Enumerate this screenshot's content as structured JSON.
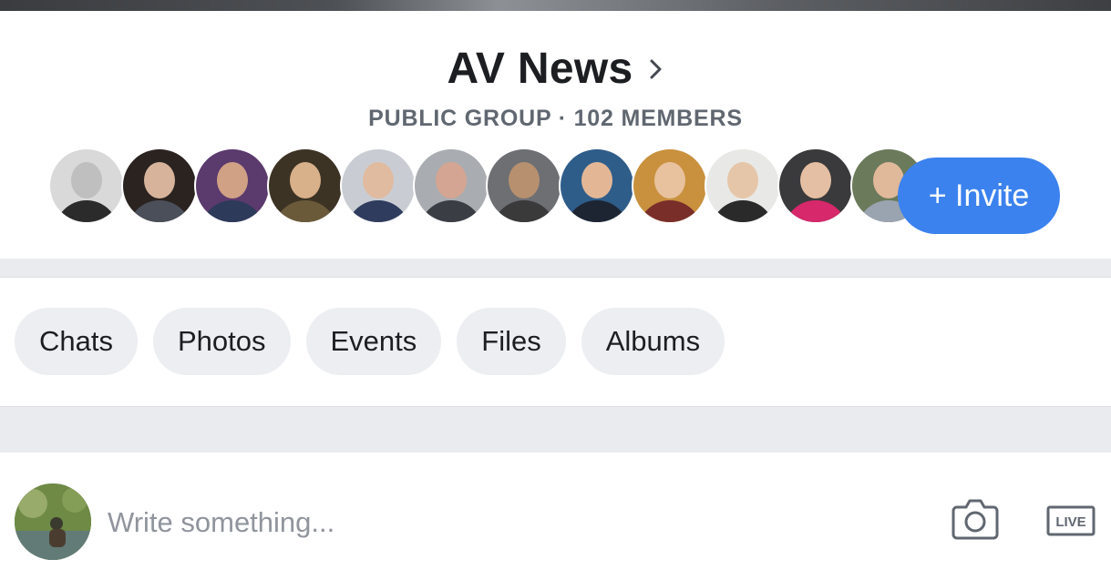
{
  "group": {
    "title": "AV News",
    "meta": "PUBLIC GROUP · 102 MEMBERS"
  },
  "members": {
    "avatars": [
      {
        "icon": "member-avatar",
        "bg": "#d9d9d9",
        "face": "#bfbfbf",
        "body": "#2b2b2b"
      },
      {
        "icon": "member-avatar",
        "bg": "#2a2320",
        "face": "#d6b39a",
        "body": "#4a4f5a"
      },
      {
        "icon": "member-avatar",
        "bg": "#5b3a6e",
        "face": "#d0a184",
        "body": "#2d3a5a"
      },
      {
        "icon": "member-avatar",
        "bg": "#3c3324",
        "face": "#d8b08a",
        "body": "#6b5a3a"
      },
      {
        "icon": "member-avatar",
        "bg": "#c9cdd3",
        "face": "#e0bba0",
        "body": "#2f3c5e"
      },
      {
        "icon": "member-avatar",
        "bg": "#a9acb0",
        "face": "#d4a592",
        "body": "#3a3d44"
      },
      {
        "icon": "member-avatar",
        "bg": "#6d6f73",
        "face": "#b7906f",
        "body": "#3a3a3a"
      },
      {
        "icon": "member-avatar",
        "bg": "#2f5d8a",
        "face": "#e3b796",
        "body": "#1d2533"
      },
      {
        "icon": "member-avatar",
        "bg": "#c9913e",
        "face": "#e8c29e",
        "body": "#7a2e2a"
      },
      {
        "icon": "member-avatar",
        "bg": "#e8e8e6",
        "face": "#e6c6a8",
        "body": "#2a2a2a"
      },
      {
        "icon": "member-avatar",
        "bg": "#3a3a3c",
        "face": "#e5bfa3",
        "body": "#d6286a"
      },
      {
        "icon": "member-avatar",
        "bg": "#6b7a5a",
        "face": "#e0b89a",
        "body": "#9aa3b0"
      }
    ]
  },
  "invite": {
    "label": "+ Invite",
    "color": "#3b82ef"
  },
  "tabs": [
    {
      "label": "Chats"
    },
    {
      "label": "Photos"
    },
    {
      "label": "Events"
    },
    {
      "label": "Files"
    },
    {
      "label": "Albums"
    }
  ],
  "composer": {
    "placeholder": "Write something...",
    "camera_icon": "camera-icon",
    "live_icon": "live-icon",
    "live_label": "LIVE"
  }
}
